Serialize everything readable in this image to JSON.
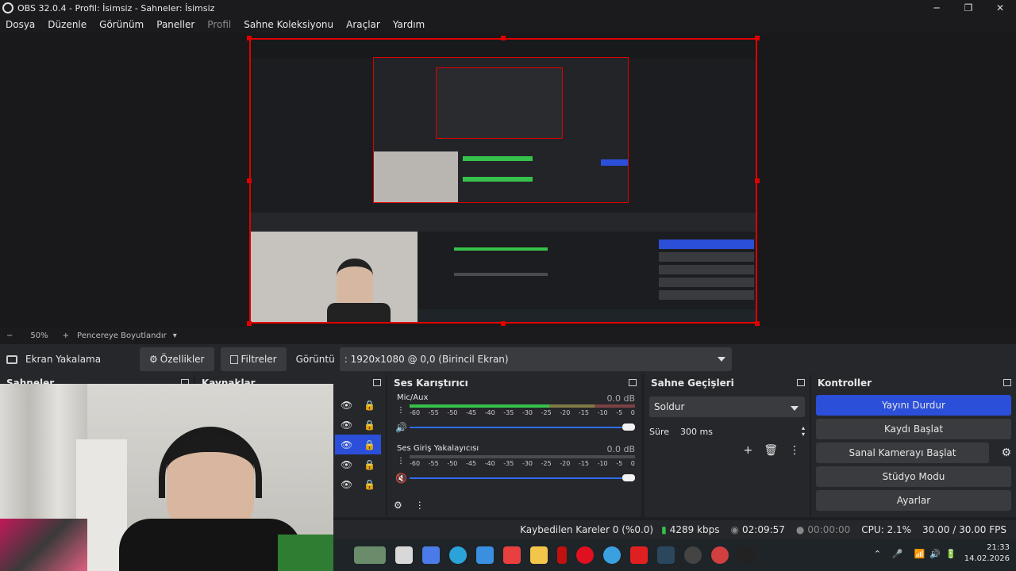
{
  "window": {
    "title": "OBS 32.0.4 - Profil: İsimsiz - Sahneler: İsimsiz",
    "minimize": "─",
    "maximize": "❐",
    "close": "✕"
  },
  "menu": {
    "items": [
      "Dosya",
      "Düzenle",
      "Görünüm",
      "Paneller",
      "Profil",
      "Sahne Koleksiyonu",
      "Araçlar",
      "Yardım"
    ]
  },
  "zoom": {
    "minus": "−",
    "value": "50%",
    "plus": "+",
    "mode": "Pencereye Boyutlandır",
    "arrow": "▾"
  },
  "source_toolbar": {
    "source_name": "Ekran Yakalama",
    "properties": "Özellikler",
    "filters": "Filtreler",
    "display_label": "Görüntü",
    "display_value": ": 1920x1080 @ 0,0 (Birincil Ekran)"
  },
  "docks": {
    "scenes_title": "Sahneler",
    "sources_title": "Kaynaklar",
    "mixer_title": "Ses Karıştırıcı",
    "transitions_title": "Sahne Geçişleri",
    "controls_title": "Kontroller"
  },
  "mixer": {
    "channels": [
      {
        "name": "Mic/Aux",
        "db": "0.0 dB",
        "level": 0.62
      },
      {
        "name": "Ses Giriş Yakalayıcısı",
        "db": "0.0 dB",
        "level": 0.0
      }
    ],
    "ticks": [
      "-60",
      "-55",
      "-50",
      "-45",
      "-40",
      "-35",
      "-30",
      "-25",
      "-20",
      "-15",
      "-10",
      "-5",
      "0"
    ]
  },
  "transitions": {
    "selected": "Soldur",
    "duration_label": "Süre",
    "duration_value": "300 ms"
  },
  "controls": {
    "stream": "Yayını Durdur",
    "record": "Kaydı Başlat",
    "virtual_cam": "Sanal Kamerayı Başlat",
    "studio": "Stüdyo Modu",
    "settings": "Ayarlar"
  },
  "status": {
    "dropped": "Kaybedilen Kareler 0 (%0.0)",
    "bitrate": "4289 kbps",
    "stream_time": "02:09:57",
    "rec_time": "00:00:00",
    "cpu": "CPU: 2.1%",
    "fps": "30.00 / 30.00 FPS"
  },
  "taskbar": {
    "time": "21:33",
    "date": "14.02.2026"
  },
  "colors": {
    "accent": "#2b4fd9",
    "selection_border": "#e00000",
    "meter_green": "#36c24a"
  }
}
